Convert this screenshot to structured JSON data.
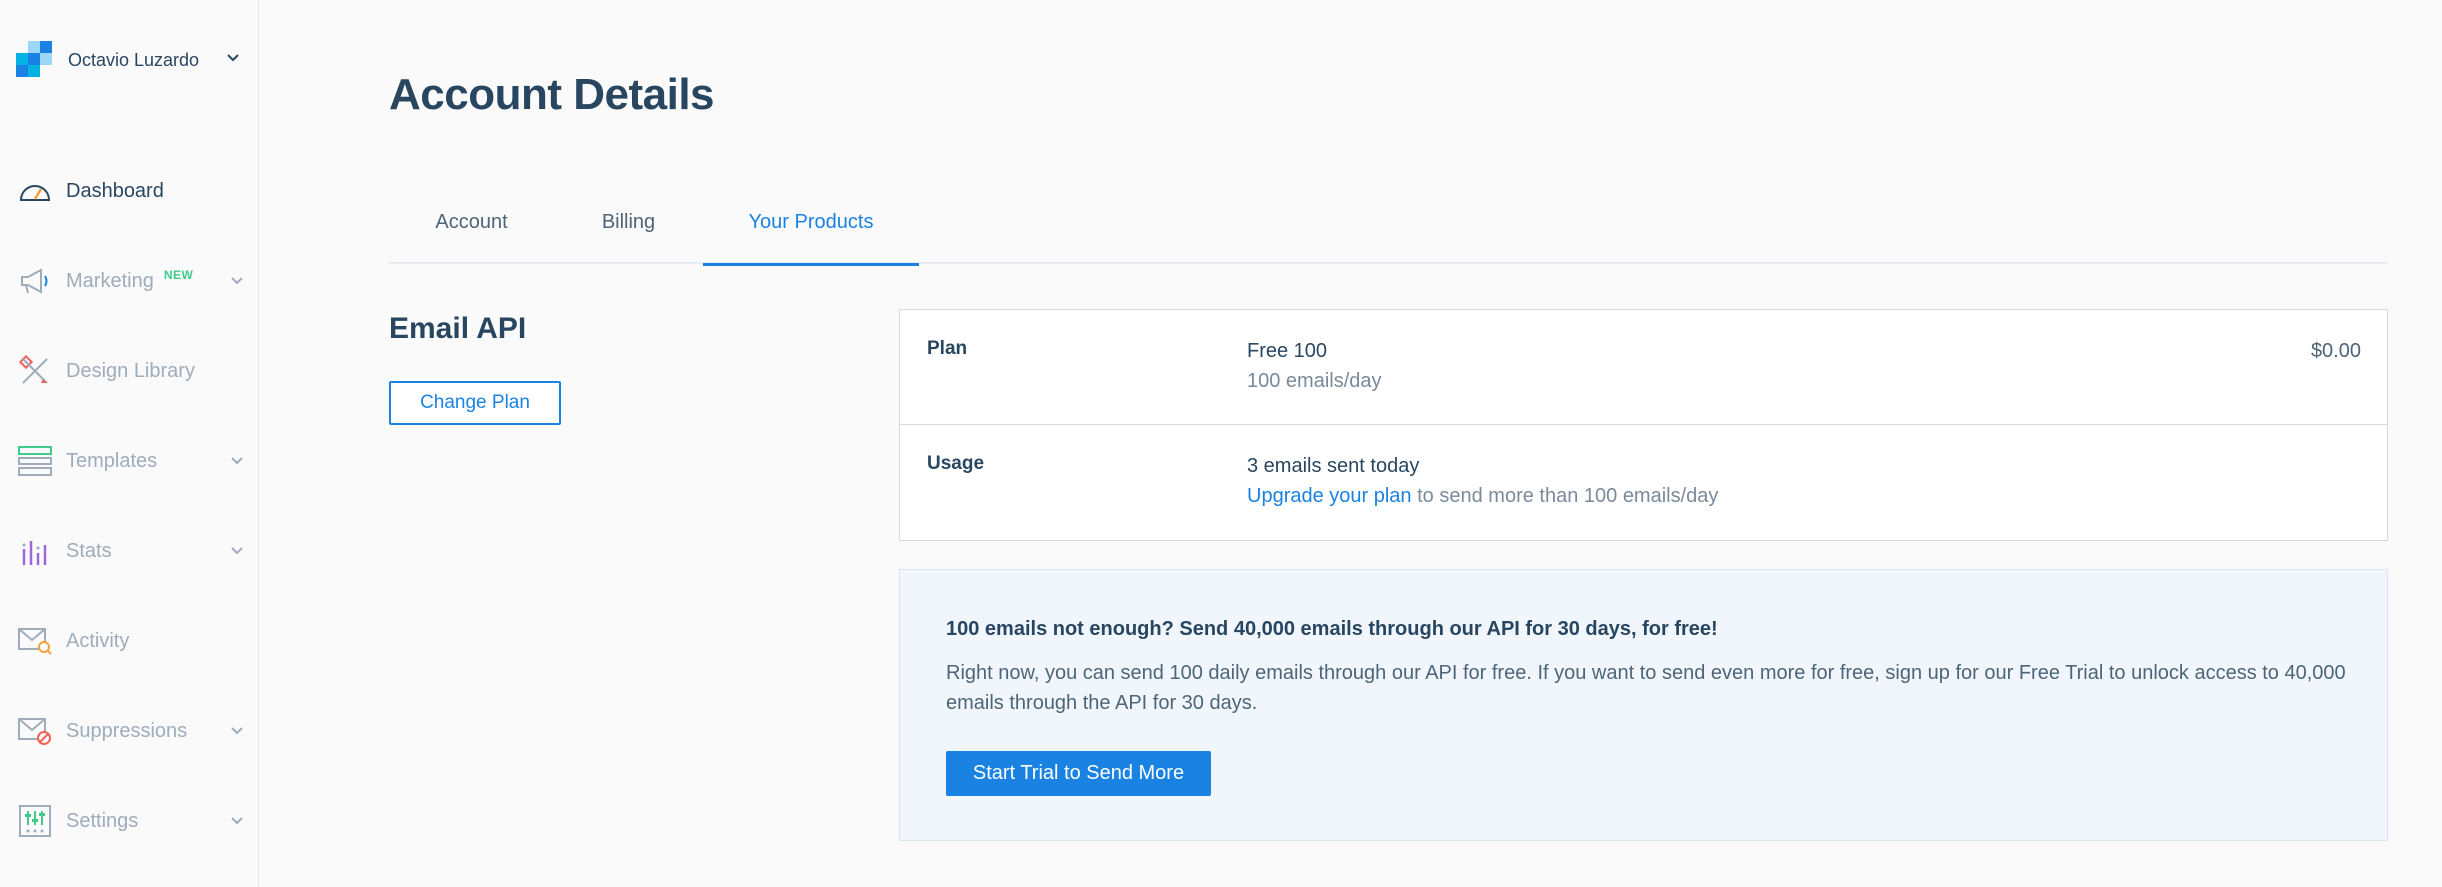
{
  "account": {
    "name": "Octavio Luzardo",
    "chevron_icon": "chevron-down-icon"
  },
  "nav": {
    "items": [
      {
        "key": "dashboard",
        "label": "Dashboard",
        "icon": "speedometer-icon",
        "active": true,
        "has_chevron": false
      },
      {
        "key": "marketing",
        "label": "Marketing",
        "icon": "megaphone-icon",
        "badge": "NEW",
        "has_chevron": true
      },
      {
        "key": "design-library",
        "label": "Design Library",
        "icon": "pencil-ruler-icon",
        "has_chevron": false
      },
      {
        "key": "templates",
        "label": "Templates",
        "icon": "template-layout-icon",
        "has_chevron": true
      },
      {
        "key": "stats",
        "label": "Stats",
        "icon": "bar-chart-icon",
        "has_chevron": true
      },
      {
        "key": "activity",
        "label": "Activity",
        "icon": "envelope-search-icon",
        "has_chevron": false
      },
      {
        "key": "suppressions",
        "label": "Suppressions",
        "icon": "envelope-block-icon",
        "has_chevron": true
      },
      {
        "key": "settings",
        "label": "Settings",
        "icon": "sliders-icon",
        "has_chevron": true
      }
    ]
  },
  "page": {
    "title": "Account Details"
  },
  "tabs": [
    {
      "label": "Account",
      "active": false
    },
    {
      "label": "Billing",
      "active": false
    },
    {
      "label": "Your Products",
      "active": true
    }
  ],
  "product": {
    "title": "Email API",
    "change_plan_label": "Change Plan",
    "plan": {
      "label": "Plan",
      "name": "Free 100",
      "limit": "100 emails/day",
      "price": "$0.00"
    },
    "usage": {
      "label": "Usage",
      "sent": "3 emails sent today",
      "upgrade_link": "Upgrade your plan",
      "upgrade_rest": " to send more than 100 emails/day"
    }
  },
  "promo": {
    "heading": "100 emails not enough? Send 40,000 emails through our API for 30 days, for free!",
    "body": "Right now, you can send 100 daily emails through our API for free. If you want to send even more for free, sign up for our Free Trial to unlock access to 40,000 emails through the API for 30 days.",
    "button_label": "Start Trial to Send More"
  },
  "colors": {
    "accent": "#1a82e2",
    "text": "#294661",
    "muted": "#9eacbb",
    "new_badge": "#3fcc8b"
  }
}
